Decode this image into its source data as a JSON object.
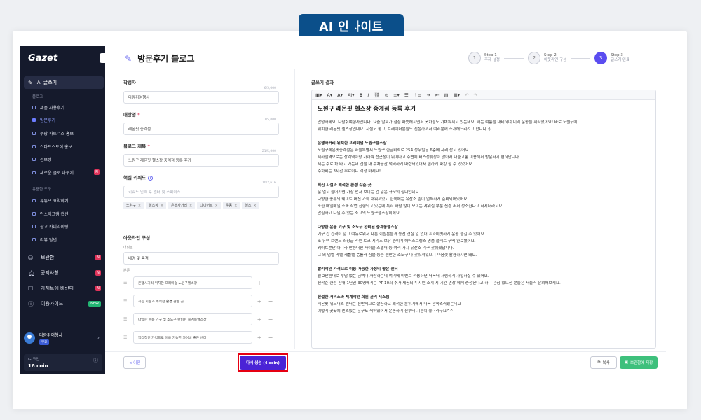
{
  "banner": {
    "title": "AI 인사이트"
  },
  "sidebar": {
    "logo": "Gazet",
    "main_item": "AI 글쓰기",
    "section_blog": "블로그",
    "blog_items": [
      "제품 사용후기",
      "방문후기",
      "쿠팡 파트너스 홍보",
      "스마트스토어 홍보",
      "정보성",
      "새로운 글로 바꾸기"
    ],
    "section_tools": "유용한 도구",
    "tool_items": [
      "유튜브 요약하기",
      "인스타그램 캡션",
      "광고 카피라이팅",
      "리뷰 답변"
    ],
    "nav_items": [
      "보관함",
      "공지사항",
      "가제트에 바란다",
      "이용가이드"
    ],
    "badge_n": "N",
    "badge_new": "NEW",
    "user": {
      "name": "다람쥐여행사",
      "tag": "무료"
    },
    "coin": {
      "label": "G-코인",
      "value": "16 coin"
    }
  },
  "header": {
    "title": "방문후기 블로그",
    "steps": [
      {
        "num": "1",
        "step": "Step 1",
        "label": "주제 설정"
      },
      {
        "num": "2",
        "step": "Step 2",
        "label": "아웃라인 구성"
      },
      {
        "num": "3",
        "step": "Step 3",
        "label": "글쓰기 완료"
      }
    ]
  },
  "form": {
    "author_label": "작성자",
    "author_value": "다람쥐여행사",
    "author_count": "6/5,000",
    "store_label": "매장명",
    "store_value": "레몬핏 중계점",
    "store_count": "7/5,000",
    "blog_title_label": "블로그 제목",
    "blog_title_value": "노원구 레몬핏 헬스장 중계점 등록 후기",
    "blog_title_count": "21/5,000",
    "keyword_label": "핵심 키워드",
    "keyword_placeholder": "키워드 입력 후 엔터 및 스페이스",
    "keyword_count": "10/2,616",
    "keywords": [
      "노원구",
      "헬스장",
      "은행사거리",
      "다이어트",
      "운동",
      "헬스"
    ],
    "outline_label": "아웃라인 구성",
    "intro_label": "머릿말",
    "intro_value": "배경 및 목적",
    "body_label": "본문",
    "outline_items": [
      "은행사거리 위치한 프리미엄 노원구헬스장",
      "최신 시설과 쾌적한 환경 갖춘 곳",
      "다양한 운동 기구 및 소도구 완비된 중계동헬스장",
      "합리적인 가격으로 이용 가능한 가성비 좋은 센터"
    ]
  },
  "result": {
    "label": "글쓰기 결과",
    "title": "노원구 레몬핏 헬스장 중계점 등록 후기",
    "paragraphs": [
      {
        "t": "p",
        "text": "안녕하세요. 다람쥐여행사입니다. 요즘 날씨가 점점 따뜻해지면서 옷차림도 가벼워지고 있는데요. 저는 여름을 대비하여 미리 운동을 시작했어요! 바로 노원구에"
      },
      {
        "t": "p",
        "text": "위치한 레몬핏 헬스장인데요. 시설도 좋고, 트레이너분들도 친절하셔서 여러분께 소개해드리려고 합니다 :)"
      },
      {
        "t": "h",
        "text": "은행사거리 위치한 프리미엄 노원구헬스장"
      },
      {
        "t": "p",
        "text": "노원구레몬핏중계점은 서울특별시 노원구 한글비석로 254 정우빌딩 6층에 자리 잡고 있어요."
      },
      {
        "t": "p",
        "text": "지하철역으로는 상계역이랑 가까워 접근성이 뛰어나고 주변에 버스정류장이 많아서 대중교통 이용해서 방문하기 편하답니다."
      },
      {
        "t": "p",
        "text": "저는 주로 차 타고 가는데 건물 내 주차공간 넉넉하게 마련돼있어서 편하게 파킹 할 수 있었어요."
      },
      {
        "t": "p",
        "text": "주차비는 3시간 무료이니 걱정 마세요!"
      },
      {
        "t": "h",
        "text": "최신 시설과 쾌적한 환경 갖춘 곳"
      },
      {
        "t": "p",
        "text": "문 열고 들어가면 가장 먼저 보이는 건 넓은 규모의 실내인데요."
      },
      {
        "t": "p",
        "text": "다양한 종류의 웨이트 머신 가득 채워져있고 한쪽에는 유산소 존이 넓찍하게 준비되어있어요."
      },
      {
        "t": "p",
        "text": "또한 매일매일 소독 작업 진행되고 있는데 특히 사람 많이 모이는 샤워실 부분 신경 써서 청소한다고 하시더라고요."
      },
      {
        "t": "p",
        "text": "안심하고 다닐 수 있는 최고의 노원구헬스장이에요."
      },
      {
        "t": "h",
        "text": "다양한 운동 기구 및 소도구 완비된 중계동헬스장"
      },
      {
        "t": "p",
        "text": "기구 간 간격이 넓고 여유로워서 다른 회원분들과 동선 겹칠 일 없어 프라이빗하게 운동 즐길 수 있어요."
      },
      {
        "t": "p",
        "text": "또 뉴텍 브랜드 최상급 라인 토크 시리즈 보유 중이며 해머스트렝스 명품 플레트 구비 완료됐어요."
      },
      {
        "t": "p",
        "text": "웨이트뿐만 아니라 만능머신 사이클 스텝퍼 등 여러 가지 유산소 기구 갖춰졌답니다."
      },
      {
        "t": "p",
        "text": "그 외 덤벨 바벨 케틀벨 폼롤러 짐볼 등등 웬만한 소도구 다 갖춰져있으니 마음껏 활용하시면 돼요."
      },
      {
        "t": "h",
        "text": "합리적인 가격으로 이용 가능한 가성비 좋은 센터"
      },
      {
        "t": "p",
        "text": "월 2만원대로 부담 없는 금액대 자랑하는데 여기에 이벤트 적용하면 더욱더 저렴하게 가입하실 수 있어요."
      },
      {
        "t": "p",
        "text": "선착순 한정 판매 1년권 30명에게는 PT 10회 추가 제공되며 지인 소개 시 기간 연장 혜택 증정된다고 하니 관심 있으신 분들은 서둘러 문의해보세요."
      },
      {
        "t": "h",
        "text": "친절한 서비스와 체계적인 회원 관리 시스템"
      },
      {
        "t": "p",
        "text": "레몬핏 위드내스 센터는 전반적으로 깔끔하고 쾌적한 분위기에서 더욱 만족스러웠는데요"
      },
      {
        "t": "p",
        "text": "이렇게 곳곳에 센스있는 문구도 적혀있어서 운동하기 전부터 기분이 좋더라구요^^"
      }
    ]
  },
  "footer": {
    "prev": "< 이전",
    "regen": "다시 생성 (4 coin)",
    "copy": "복사",
    "save": "보관함에 저장"
  }
}
